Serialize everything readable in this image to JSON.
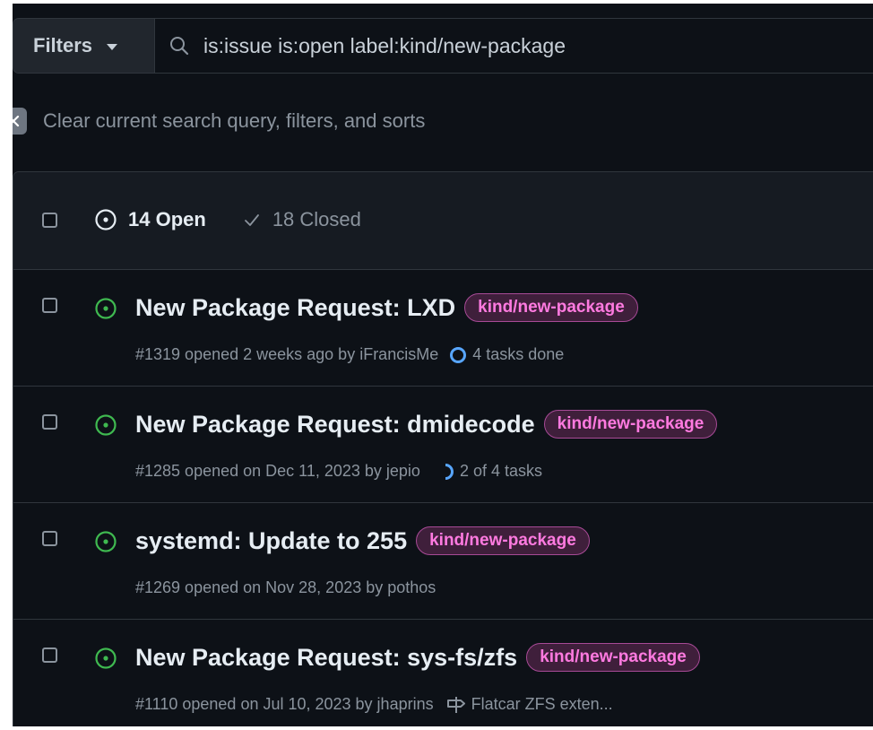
{
  "filters": {
    "button_label": "Filters",
    "search_value": "is:issue is:open label:kind/new-package"
  },
  "clear_query": {
    "label": "Clear current search query, filters, and sorts"
  },
  "states": {
    "open_label": "14 Open",
    "closed_label": "18 Closed"
  },
  "colors": {
    "open_icon": "#3fb950",
    "label_text": "#ff7ae0",
    "progress": "#58a6ff"
  },
  "issues": [
    {
      "title": "New Package Request: LXD",
      "label": "kind/new-package",
      "meta": "#1319 opened 2 weeks ago by iFrancisMe",
      "task_icon": "circle-progress-icon",
      "task_text": "4 tasks done"
    },
    {
      "title": "New Package Request: dmidecode",
      "label": "kind/new-package",
      "meta": "#1285 opened on Dec 11, 2023 by jepio",
      "task_icon": "partial-progress-icon",
      "task_text": "2 of 4 tasks"
    },
    {
      "title": "systemd: Update to 255",
      "label": "kind/new-package",
      "meta": "#1269 opened on Nov 28, 2023 by pothos"
    },
    {
      "title": "New Package Request: sys-fs/zfs",
      "label": "kind/new-package",
      "meta": "#1110 opened on Jul 10, 2023 by jhaprins",
      "task_icon": "milestone-icon",
      "task_text": "Flatcar ZFS exten..."
    }
  ]
}
